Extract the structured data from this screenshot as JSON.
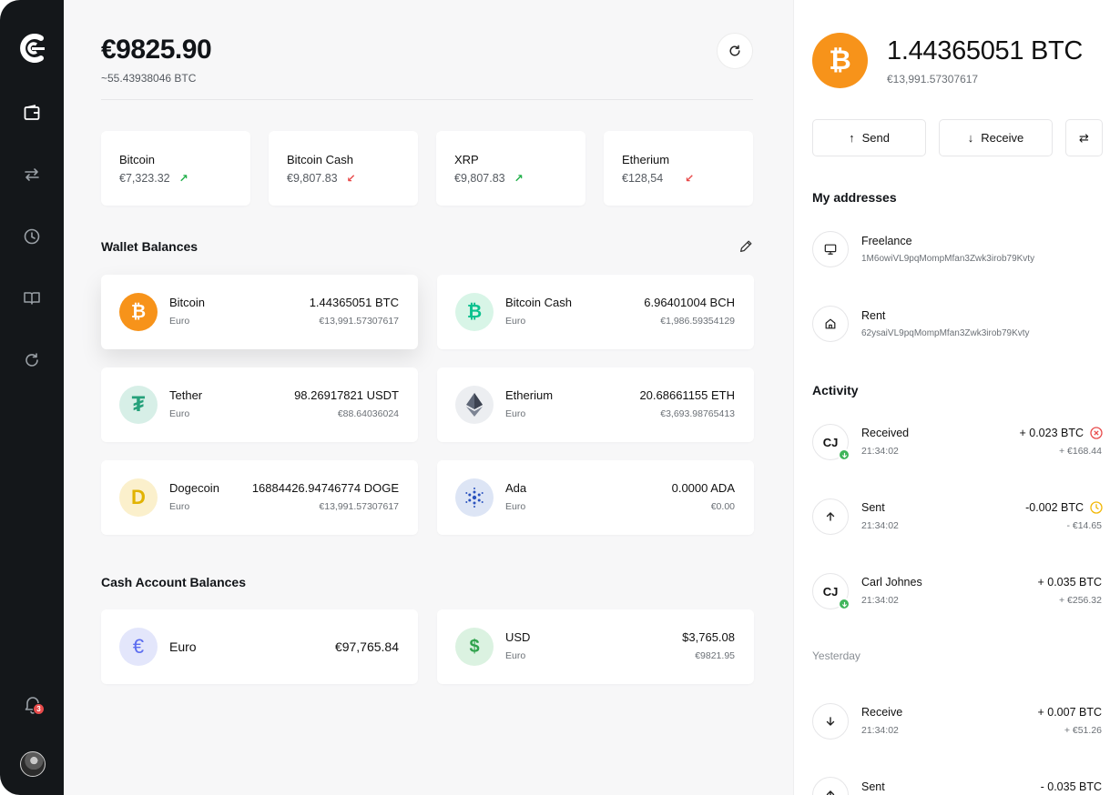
{
  "sidebar": {
    "notification_count": "3"
  },
  "summary": {
    "total": "€9825.90",
    "total_btc": "~55.43938046 BTC"
  },
  "tickers": [
    {
      "name": "Bitcoin",
      "value": "€7,323.32",
      "trend": "up"
    },
    {
      "name": "Bitcoin Cash",
      "value": "€9,807.83",
      "trend": "down"
    },
    {
      "name": "XRP",
      "value": "€9,807.83",
      "trend": "up"
    },
    {
      "name": "Etherium",
      "value": "€128,54",
      "trend": "down"
    }
  ],
  "wallet_balances": {
    "title": "Wallet Balances",
    "items": [
      {
        "name": "Bitcoin",
        "sub": "Euro",
        "amount": "1.44365051 BTC",
        "eur": "€13,991.57307617",
        "icon": "bitcoin-icon",
        "color": "#f7931a"
      },
      {
        "name": "Bitcoin Cash",
        "sub": "Euro",
        "amount": "6.96401004 BCH",
        "eur": "€1,986.59354129",
        "icon": "bitcoin-cash-icon",
        "color": "#0ac18e"
      },
      {
        "name": "Tether",
        "sub": "Euro",
        "amount": "98.26917821 USDT",
        "eur": "€88.64036024",
        "icon": "tether-icon",
        "color": "#26a17b"
      },
      {
        "name": "Etherium",
        "sub": "Euro",
        "amount": "20.68661155 ETH",
        "eur": "€3,693.98765413",
        "icon": "ethereum-icon",
        "color": "#6b7280"
      },
      {
        "name": "Dogecoin",
        "sub": "Euro",
        "amount": "16884426.94746774 DOGE",
        "eur": "€13,991.57307617",
        "icon": "dogecoin-icon",
        "color": "#e1b303"
      },
      {
        "name": "Ada",
        "sub": "Euro",
        "amount": "0.0000 ADA",
        "eur": "€0.00",
        "icon": "cardano-icon",
        "color": "#2a52be"
      }
    ]
  },
  "cash_balances": {
    "title": "Cash Account Balances",
    "items": [
      {
        "name": "Euro",
        "amount": "€97,765.84",
        "icon": "euro-icon",
        "color": "#5b6cf0"
      },
      {
        "name": "USD",
        "sub": "Euro",
        "amount": "$3,765.08",
        "eur": "€9821.95",
        "icon": "dollar-icon",
        "color": "#2fa24c"
      }
    ]
  },
  "selected": {
    "amount": "1.44365051 BTC",
    "eur": "€13,991.57307617",
    "send_label": "Send",
    "receive_label": "Receive"
  },
  "addresses": {
    "title": "My addresses",
    "items": [
      {
        "name": "Freelance",
        "address": "1M6owiVL9pqMompMfan3Zwk3irob79Kvty",
        "icon": "monitor-icon"
      },
      {
        "name": "Rent",
        "address": "62ysaiVL9pqMompMfan3Zwk3irob79Kvty",
        "icon": "home-icon"
      }
    ]
  },
  "activity": {
    "title": "Activity",
    "yesterday_label": "Yesterday",
    "items": [
      {
        "avatar": "CJ",
        "title": "Received",
        "time": "21:34:02",
        "amount": "+ 0.023 BTC",
        "eur": "+ €168.44",
        "status": "failed"
      },
      {
        "avatar": "",
        "title": "Sent",
        "time": "21:34:02",
        "amount": "-0.002 BTC",
        "eur": "- €14.65",
        "status": "pending"
      },
      {
        "avatar": "CJ",
        "title": "Carl Johnes",
        "time": "21:34:02",
        "amount": "+ 0.035 BTC",
        "eur": "+ €256.32",
        "status": ""
      },
      {
        "avatar": "",
        "title": "Receive",
        "time": "21:34:02",
        "amount": "+ 0.007 BTC",
        "eur": "+ €51.26",
        "status": ""
      },
      {
        "avatar": "",
        "title": "Sent",
        "time": "",
        "amount": "- 0.035 BTC",
        "eur": "",
        "status": ""
      }
    ]
  }
}
